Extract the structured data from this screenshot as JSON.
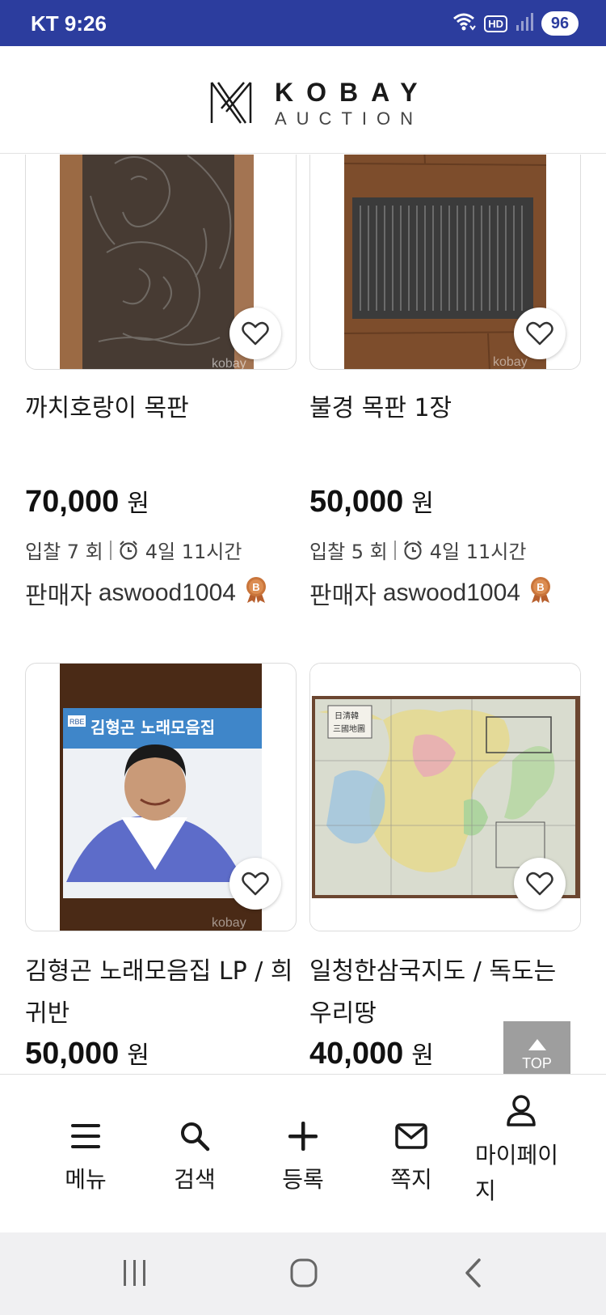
{
  "status_bar": {
    "carrier_time": "KT 9:26",
    "hd_label": "HD",
    "battery": "96"
  },
  "header": {
    "logo_main": "KOBAY",
    "logo_sub": "AUCTION"
  },
  "items": [
    {
      "title": "까치호랑이 목판",
      "price": "70,000",
      "currency": "원",
      "bids": "입찰 7 회",
      "time_left": "4일 11시간",
      "seller_label": "판매자",
      "seller_id": "aswood1004",
      "image_watermark": "kobay",
      "image_icon": "tiger-woodblock-image"
    },
    {
      "title": "불경 목판 1장",
      "price": "50,000",
      "currency": "원",
      "bids": "입찰 5 회",
      "time_left": "4일 11시간",
      "seller_label": "판매자",
      "seller_id": "aswood1004",
      "image_watermark": "kobay",
      "image_icon": "sutra-woodblock-image"
    },
    {
      "title": "김형곤 노래모음집 LP / 희귀반",
      "price": "50,000",
      "currency": "원",
      "image_watermark": "kobay",
      "image_icon": "lp-record-image",
      "cover_title": "김형곤 노래모음집",
      "cover_badge": "RBE"
    },
    {
      "title": "일청한삼국지도 / 독도는 우리땅",
      "price": "40,000",
      "currency": "원",
      "image_icon": "old-map-image",
      "map_label_1": "日淸韓",
      "map_label_2": "三國地圖"
    }
  ],
  "top_button": {
    "label": "TOP"
  },
  "bottom_nav": [
    {
      "label": "메뉴",
      "icon": "hamburger-icon"
    },
    {
      "label": "검색",
      "icon": "search-icon"
    },
    {
      "label": "등록",
      "icon": "plus-icon"
    },
    {
      "label": "쪽지",
      "icon": "mail-icon"
    },
    {
      "label": "마이페이지",
      "icon": "user-icon"
    }
  ],
  "colors": {
    "status_bar": "#2c3d9e",
    "medal": "#c9753b"
  }
}
